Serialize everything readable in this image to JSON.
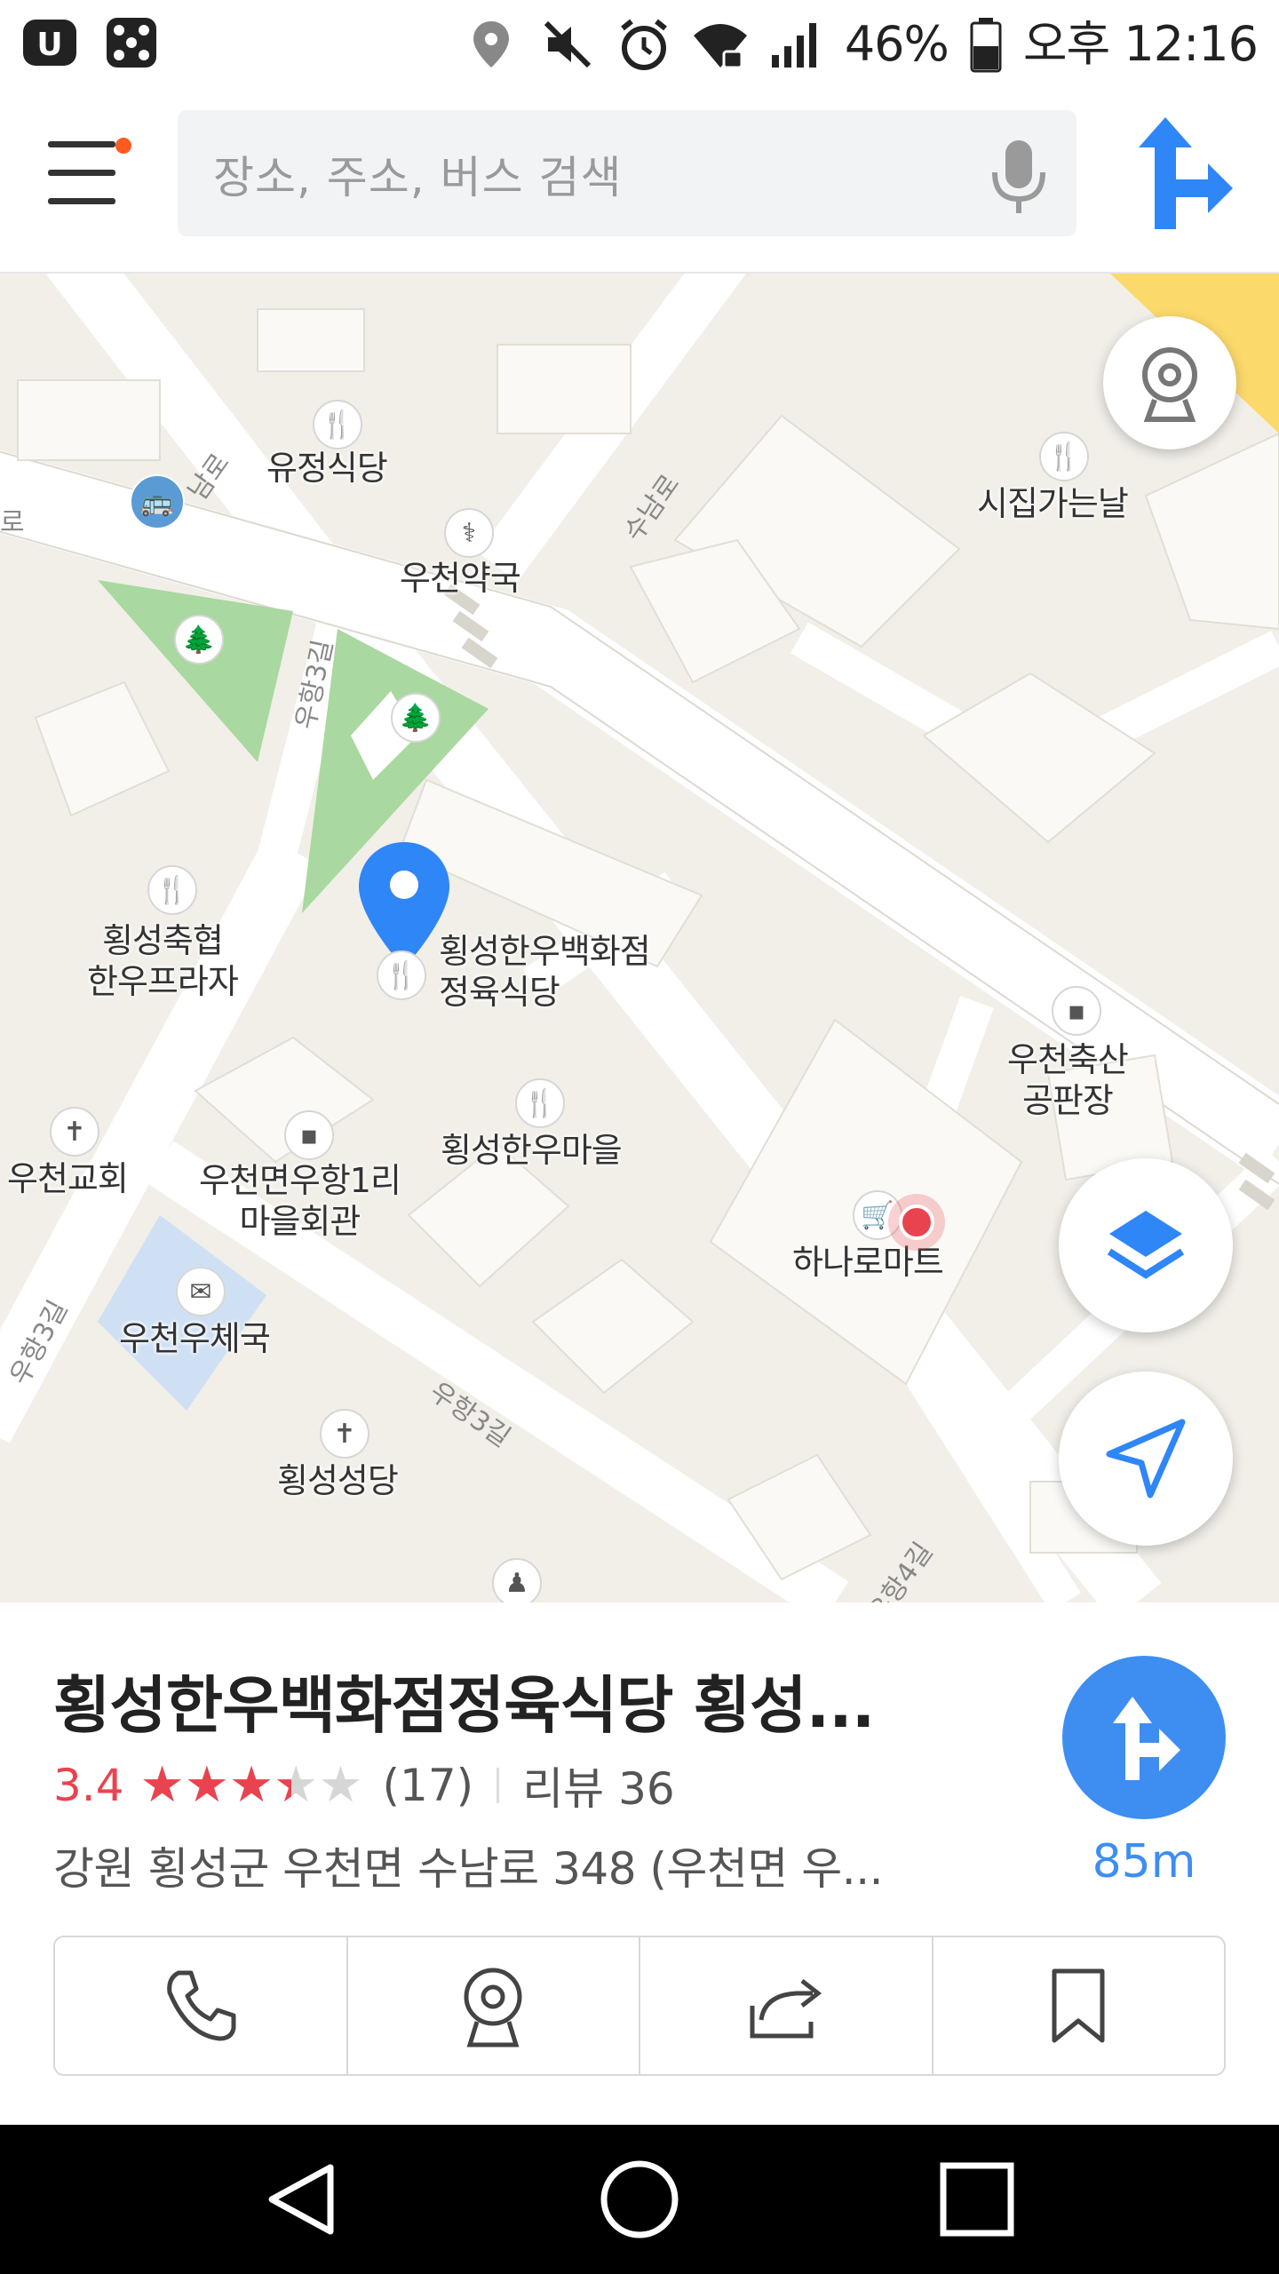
{
  "status_bar": {
    "battery": "46%",
    "time": "오후 12:16",
    "icons": [
      "uplus-icon",
      "dice-icon",
      "location-icon",
      "mute-icon",
      "alarm-icon",
      "wifi-icon",
      "signal-icon",
      "battery-icon"
    ]
  },
  "search": {
    "placeholder": "장소, 주소, 버스 검색"
  },
  "map": {
    "accent": "#3d8ef0",
    "pin_color": "#2f86f6",
    "park_color": "#a9d8a0",
    "places": [
      {
        "name": "유정식당"
      },
      {
        "name": "우천약국"
      },
      {
        "name": "시집가는날"
      },
      {
        "name": "횡성축협\n한우프라자"
      },
      {
        "name": "횡성한우백화점\n정육식당"
      },
      {
        "name": "횡성한우마을"
      },
      {
        "name": "우천축산\n공판장"
      },
      {
        "name": "우천교회"
      },
      {
        "name": "우천면우항1리\n마을회관"
      },
      {
        "name": "하나로마트"
      },
      {
        "name": "우천우체국"
      },
      {
        "name": "횡성성당"
      }
    ],
    "roads": [
      "수남로",
      "우항3길",
      "우항3길",
      "우항3길",
      "우항4길",
      "로",
      "남로"
    ]
  },
  "place": {
    "title": "횡성한우백화점정육식당 횡성...",
    "rating": "3.4",
    "rating_value": 3.4,
    "rating_max": 5,
    "review_count": "(17)",
    "reviews": "리뷰 36",
    "address": "강원 횡성군 우천면 수남로 348 (우천면 우...",
    "distance": "85m",
    "star_color": "#e9434f"
  },
  "actions": [
    {
      "icon": "phone-icon"
    },
    {
      "icon": "street-view-icon"
    },
    {
      "icon": "share-icon"
    },
    {
      "icon": "bookmark-icon"
    }
  ]
}
